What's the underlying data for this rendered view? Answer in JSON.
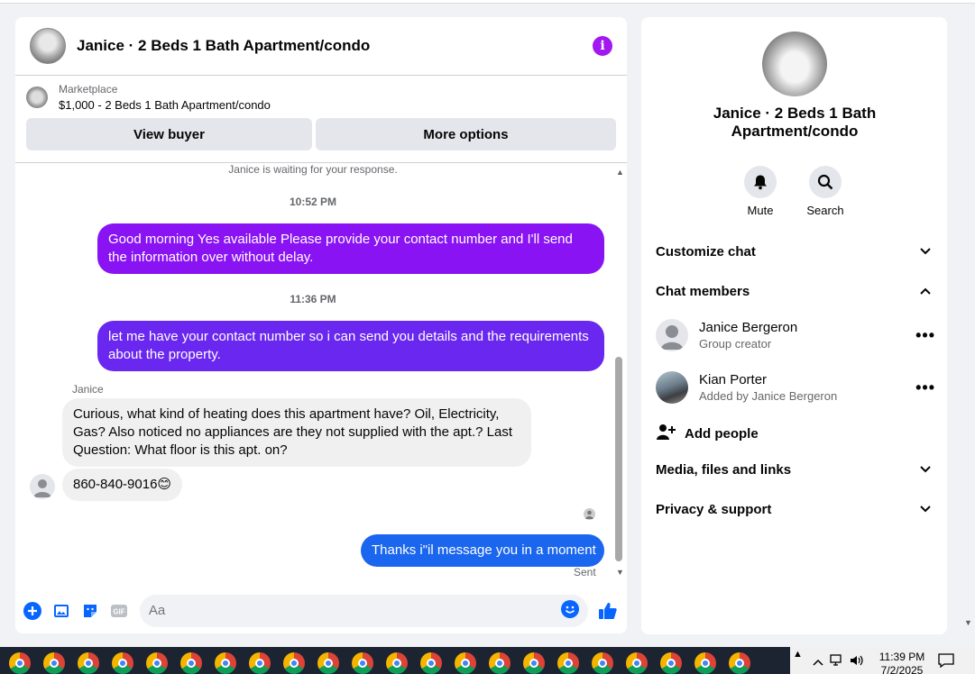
{
  "chat": {
    "title": "Janice · 2 Beds 1 Bath Apartment/condo",
    "info_icon": "i",
    "marketplace": {
      "label": "Marketplace",
      "listing": "$1,000 - 2 Beds 1 Bath Apartment/condo",
      "view_buyer": "View buyer",
      "more_options": "More options"
    },
    "waiting_note": "Janice is waiting for your response.",
    "time1": "10:52 PM",
    "msg1": "Good morning Yes available Please provide your contact number and I'll send the information over without delay.",
    "time2": "11:36 PM",
    "msg2": "let me have your contact number so i can send you details and the requirements about the property.",
    "sender": "Janice",
    "in1": "Curious, what kind of  heating does this apartment have?  Oil, Electricity, Gas? Also noticed no appliances are they not supplied with the apt.?  Last Question:  What floor is this apt. on?",
    "in2": "860-840-9016",
    "in2_emoji": "😊",
    "msg3": "Thanks i\"il message you in a moment",
    "status": "Sent",
    "composer_placeholder": "Aa"
  },
  "side": {
    "title": "Janice · 2 Beds 1 Bath Apartment/condo",
    "mute": "Mute",
    "search": "Search",
    "customize": "Customize chat",
    "members_header": "Chat members",
    "members": [
      {
        "name": "Janice Bergeron",
        "role": "Group creator"
      },
      {
        "name": "Kian Porter",
        "role": "Added by Janice Bergeron"
      }
    ],
    "add_people": "Add people",
    "media": "Media, files and links",
    "privacy": "Privacy & support"
  },
  "taskbar": {
    "time": "11:39 PM",
    "date": "7/2/2025"
  },
  "colors": {
    "accent_purple": "#a218f0",
    "bubble1": "#8a13f3",
    "bubble2": "#6a27ef",
    "bubble3": "#1a66ee",
    "icon_blue": "#0866ff"
  }
}
